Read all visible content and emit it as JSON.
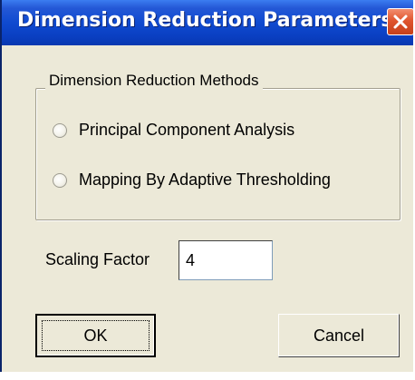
{
  "window": {
    "title": "Dimension Reduction Parameters",
    "close_icon": "close-icon"
  },
  "group": {
    "legend": "Dimension Reduction Methods",
    "options": [
      {
        "label": "Principal Component Analysis",
        "selected": false
      },
      {
        "label": "Mapping By Adaptive Thresholding",
        "selected": false
      }
    ]
  },
  "scaling": {
    "label": "Scaling Factor",
    "value": "4"
  },
  "buttons": {
    "ok_label": "OK",
    "cancel_label": "Cancel"
  },
  "colors": {
    "titlebar": "#0f4ad0",
    "window_bg": "#ece9d8",
    "close_button": "#e0552e"
  }
}
